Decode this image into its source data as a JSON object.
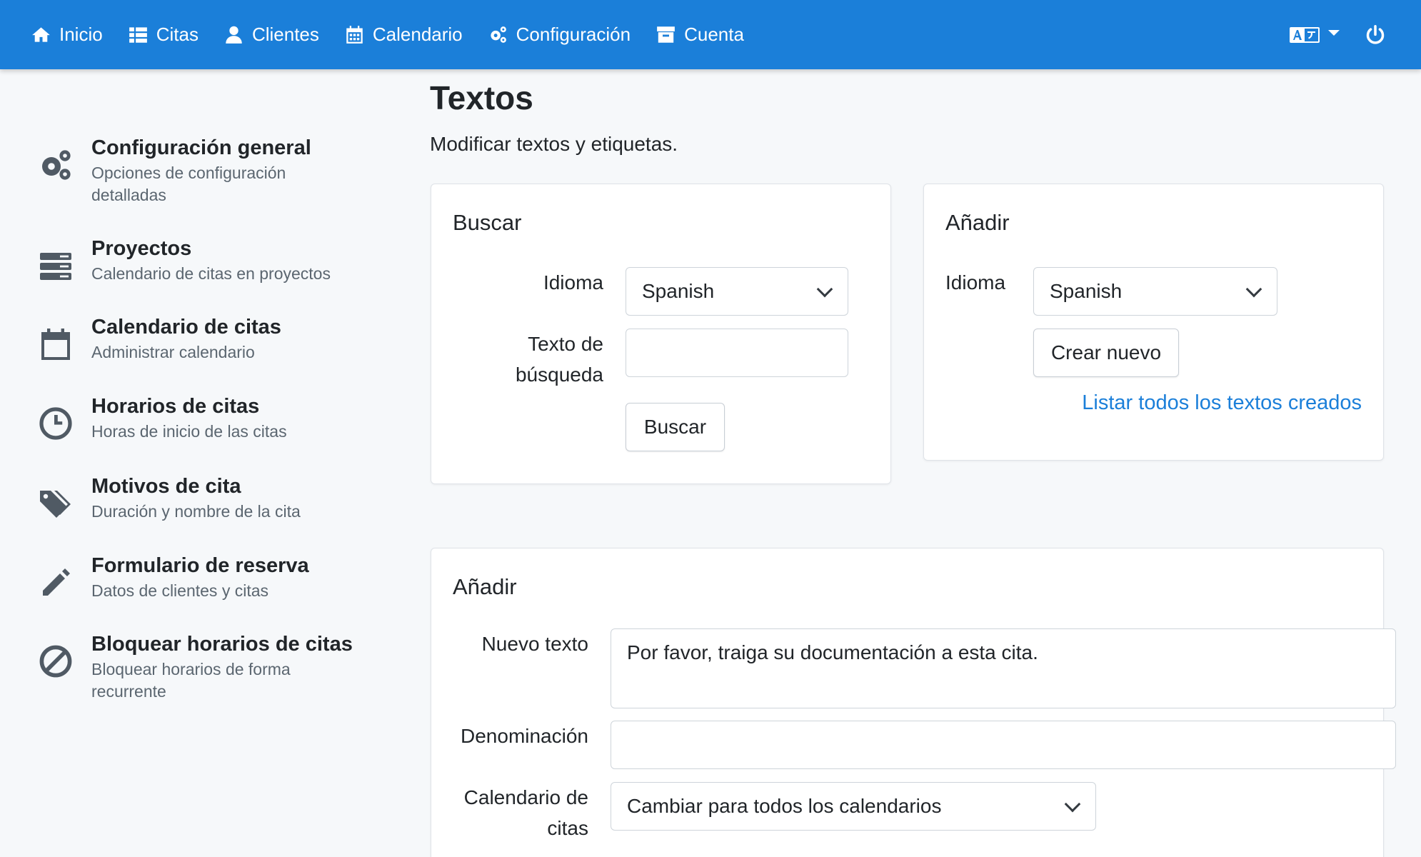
{
  "navbar": {
    "items": [
      {
        "label": "Inicio",
        "icon": "home-icon"
      },
      {
        "label": "Citas",
        "icon": "list-icon"
      },
      {
        "label": "Clientes",
        "icon": "user-icon"
      },
      {
        "label": "Calendario",
        "icon": "calendar-icon"
      },
      {
        "label": "Configuración",
        "icon": "gears-icon"
      },
      {
        "label": "Cuenta",
        "icon": "inbox-icon"
      }
    ],
    "language_icon": "translate-icon",
    "logout_icon": "power-icon",
    "bg_color": "#1b7fd9"
  },
  "sidebar": {
    "items": [
      {
        "title": "Configuración general",
        "subtitle": "Opciones de configuración detalladas",
        "icon": "gears-icon"
      },
      {
        "title": "Proyectos",
        "subtitle": "Calendario de citas en proyectos",
        "icon": "server-icon"
      },
      {
        "title": "Calendario de citas",
        "subtitle": "Administrar calendario",
        "icon": "calendar-icon"
      },
      {
        "title": "Horarios de citas",
        "subtitle": "Horas de inicio de las citas",
        "icon": "clock-icon"
      },
      {
        "title": "Motivos de cita",
        "subtitle": "Duración y nombre de la cita",
        "icon": "tags-icon"
      },
      {
        "title": "Formulario de reserva",
        "subtitle": "Datos de clientes y citas",
        "icon": "pencil-icon"
      },
      {
        "title": "Bloquear horarios de citas",
        "subtitle": "Bloquear horarios de forma recurrente",
        "icon": "ban-icon"
      }
    ]
  },
  "page": {
    "title": "Textos",
    "subtitle": "Modificar textos y etiquetas."
  },
  "search_card": {
    "title": "Buscar",
    "language_label": "Idioma",
    "language_value": "Spanish",
    "search_text_label": "Texto de búsqueda",
    "search_text_value": "",
    "search_button": "Buscar"
  },
  "add_card": {
    "title": "Añadir",
    "language_label": "Idioma",
    "language_value": "Spanish",
    "create_button": "Crear nuevo",
    "list_link": "Listar todos los textos creados"
  },
  "add_form": {
    "title": "Añadir",
    "new_text_label": "Nuevo texto",
    "new_text_value": "Por favor, traiga su documentación a esta cita.",
    "denomination_label": "Denominación",
    "denomination_value": "",
    "calendar_label": "Calendario de citas",
    "calendar_value": "Cambiar para todos los calendarios"
  }
}
